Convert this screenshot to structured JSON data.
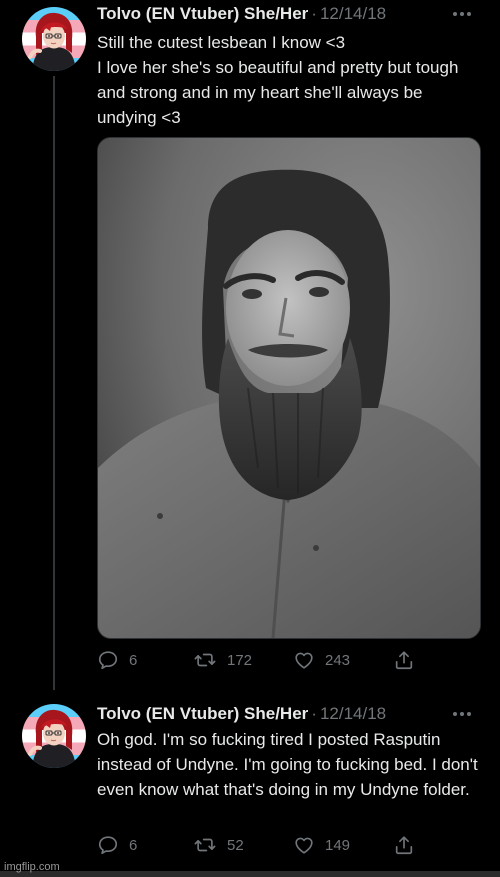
{
  "tweets": [
    {
      "author": "Tolvo (EN Vtuber) She/Her",
      "separator": "·",
      "date": "12/14/18",
      "text_lines": [
        "Still the cutest lesbean I know <3",
        "I love her she's so beautiful and pretty but tough and strong and in my heart she'll always be undying <3"
      ],
      "has_media": true,
      "replies": "6",
      "retweets": "172",
      "likes": "243"
    },
    {
      "author": "Tolvo (EN Vtuber) She/Her",
      "separator": "·",
      "date": "12/14/18",
      "text_lines": [
        "Oh god. I'm so fucking tired I posted Rasputin instead of Undyne. I'm going to fucking bed. I don't even know what that's doing in my Undyne folder."
      ],
      "replies": "6",
      "retweets": "52",
      "likes": "149"
    }
  ],
  "watermark": "imgflip.com",
  "colors": {
    "background": "#000000",
    "text": "#e7e9ea",
    "muted": "#71767b",
    "thread_line": "#333639"
  },
  "icons": [
    "reply-icon",
    "retweet-icon",
    "like-icon",
    "share-icon",
    "more-icon"
  ]
}
